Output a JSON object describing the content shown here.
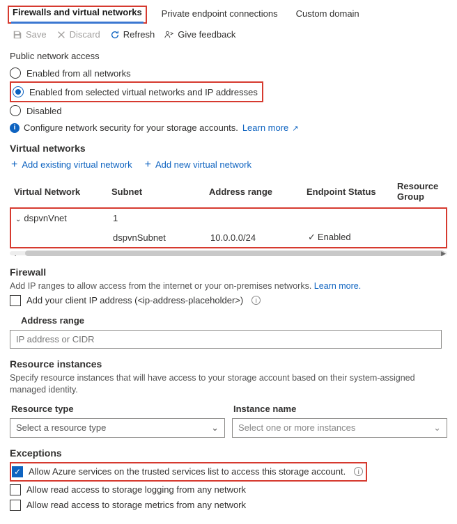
{
  "tabs": {
    "firewalls": "Firewalls and virtual networks",
    "pec": "Private endpoint connections",
    "custom": "Custom domain"
  },
  "toolbar": {
    "save": "Save",
    "discard": "Discard",
    "refresh": "Refresh",
    "feedback": "Give feedback"
  },
  "pna": {
    "label": "Public network access",
    "opt_all": "Enabled from all networks",
    "opt_selected": "Enabled from selected virtual networks and IP addresses",
    "opt_disabled": "Disabled",
    "info_text": "Configure network security for your storage accounts.",
    "learn_more": "Learn more"
  },
  "vnets": {
    "heading": "Virtual networks",
    "add_existing": "Add existing virtual network",
    "add_new": "Add new virtual network",
    "cols": {
      "vn": "Virtual Network",
      "subnet": "Subnet",
      "range": "Address range",
      "status": "Endpoint Status",
      "rg": "Resource Group"
    },
    "row1": {
      "name": "dspvnVnet",
      "count": "1"
    },
    "row2": {
      "subnet": "dspvnSubnet",
      "range": "10.0.0.0/24",
      "status": "Enabled"
    }
  },
  "firewall": {
    "heading": "Firewall",
    "help": "Add IP ranges to allow access from the internet or your on-premises networks.",
    "learn_more": "Learn more.",
    "add_client_prefix": "Add your client IP address (",
    "add_client_ip": "<ip-address-placeholder>",
    "add_client_suffix": ")",
    "addr_label": "Address range",
    "addr_placeholder": "IP address or CIDR"
  },
  "ri": {
    "heading": "Resource instances",
    "help": "Specify resource instances that will have access to your storage account based on their system-assigned managed identity.",
    "col_type": "Resource type",
    "col_name": "Instance name",
    "sel_type_ph": "Select a resource type",
    "sel_name_ph": "Select one or more instances"
  },
  "ex": {
    "heading": "Exceptions",
    "opt_trusted": "Allow Azure services on the trusted services list to access this storage account.",
    "opt_logging": "Allow read access to storage logging from any network",
    "opt_metrics": "Allow read access to storage metrics from any network"
  }
}
